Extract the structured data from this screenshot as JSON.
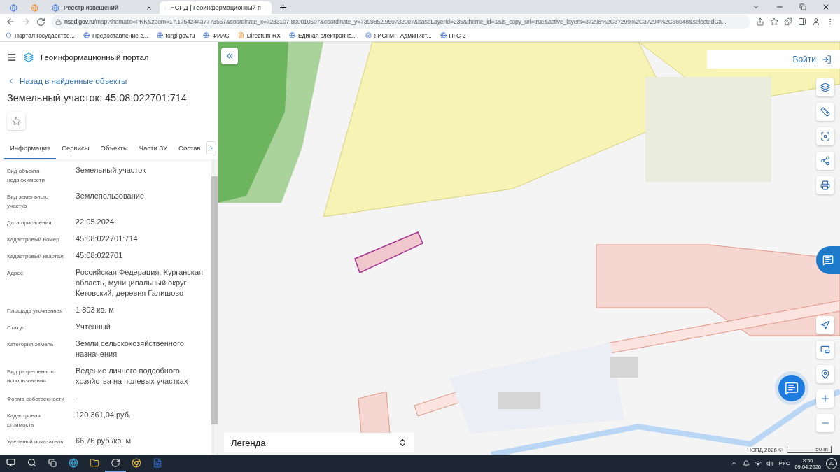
{
  "browser": {
    "tabs": [
      {
        "kind": "pinned",
        "selected": false
      },
      {
        "kind": "pinned",
        "selected": false
      },
      {
        "kind": "normal",
        "title": "Реестр извещений",
        "selected": false
      },
      {
        "kind": "normal",
        "title": "НСПД | Геоинформационный п",
        "selected": true
      }
    ],
    "address": {
      "host": "nspd.gov.ru",
      "path": "/map?thematic=PKK&zoom=17.175424437773557&coordinate_x=7233107.800010597&coordinate_y=7399852.959732007&baseLayerId=235&theme_id=1&is_copy_url=true&active_layers=37298%2C37299%2C37294%2C36048&selectedCa..."
    },
    "bookmarks": [
      "Портал государстве...",
      "Предоставление с...",
      "torgi.gov.ru",
      "ФИАС",
      "Directum RX",
      "Единая электронна...",
      "ГИСГМП Админист...",
      "ПГС 2"
    ]
  },
  "panel": {
    "app_title": "Геоинформационный портал",
    "back_link": "Назад в найденные объекты",
    "title": "Земельный участок: 45:08:022701:714",
    "favorite": false,
    "tabs": [
      {
        "label": "Информация",
        "selected": true
      },
      {
        "label": "Сервисы",
        "selected": false
      },
      {
        "label": "Объекты",
        "selected": false
      },
      {
        "label": "Части ЗУ",
        "selected": false
      },
      {
        "label": "Состав",
        "selected": false
      }
    ],
    "fields": [
      {
        "label": "Вид объекта недвижимости",
        "value": "Земельный участок"
      },
      {
        "label": "Вид земельного участка",
        "value": "Землепользование"
      },
      {
        "label": "Дата присвоения",
        "value": "22.05.2024"
      },
      {
        "label": "Кадастровый номер",
        "value": "45:08:022701:714"
      },
      {
        "label": "Кадастровый квартал",
        "value": "45:08:022701"
      },
      {
        "label": "Адрес",
        "value": "Российская Федерация, Курганская область, муниципальный округ Кетовский, деревня Галишово"
      },
      {
        "label": "Площадь уточненная",
        "value": "1 803 кв. м"
      },
      {
        "label": "Статус",
        "value": "Учтенный"
      },
      {
        "label": "Категория земель",
        "value": "Земли сельскохозяйственного назначения"
      },
      {
        "label": "Вид разрешенного использования",
        "value": "Ведение личного подсобного хозяйства на полевых участках"
      },
      {
        "label": "Форма собственности",
        "value": "-"
      },
      {
        "label": "Кадастровая стоимость",
        "value": "120 361,04 руб."
      },
      {
        "label": "Удельный показатель",
        "value": "66,76 руб./кв. м"
      }
    ]
  },
  "map": {
    "kind": "picture",
    "login": "Войти",
    "legend": "Легенда",
    "attribution": "НСПД 2026 ©",
    "scale": "50 m"
  },
  "taskbar": {
    "language": "РУС",
    "time": "8:56",
    "date": "09.04.2026",
    "notifications": "20"
  }
}
